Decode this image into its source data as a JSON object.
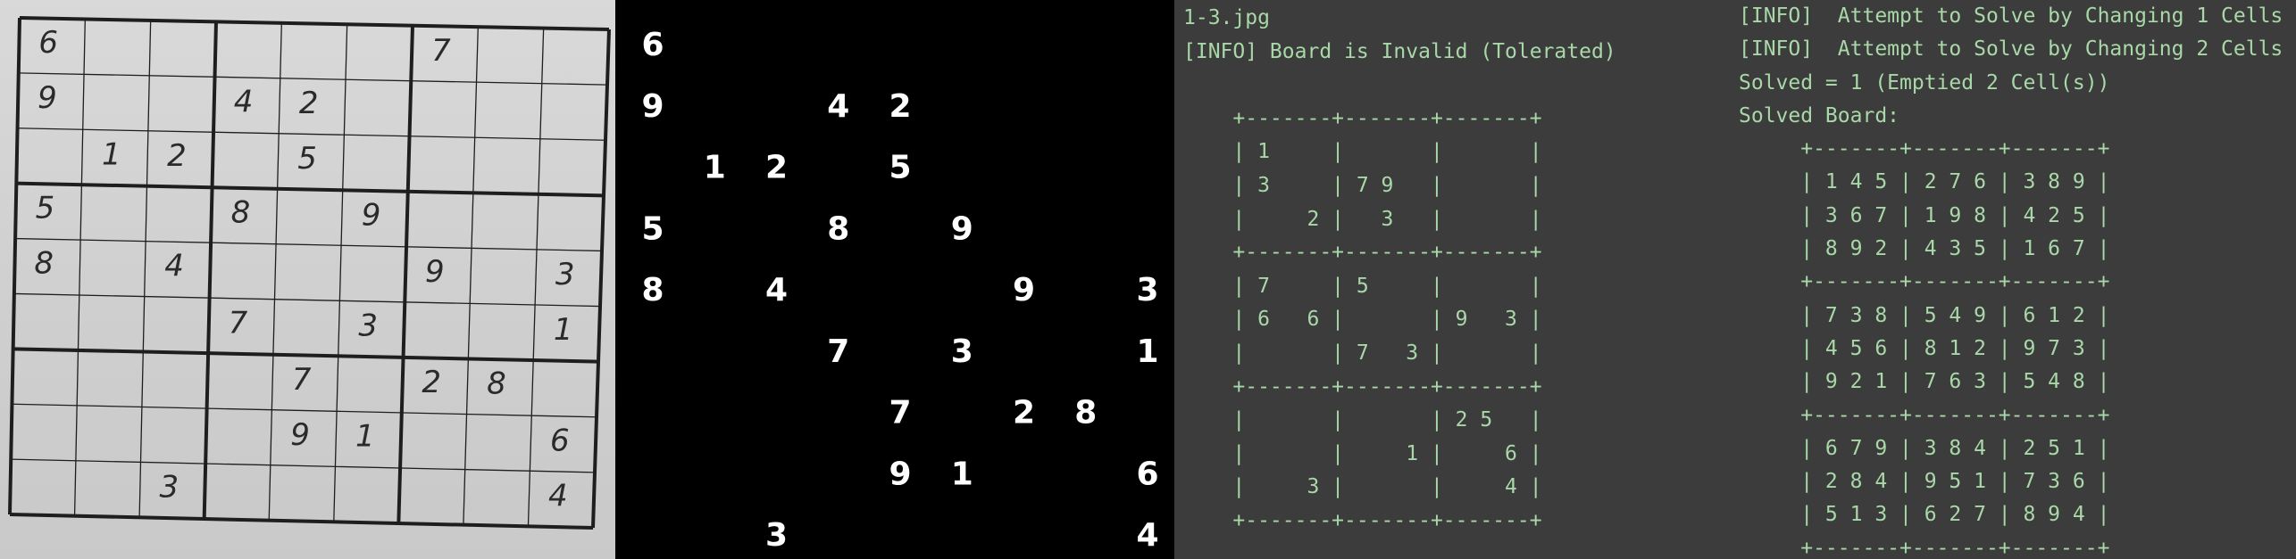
{
  "photo_board": {
    "rows": [
      [
        "6",
        "",
        "",
        "",
        "",
        "",
        "7",
        "",
        ""
      ],
      [
        "9",
        "",
        "",
        "4",
        "2",
        "",
        "",
        "",
        ""
      ],
      [
        "",
        "1",
        "2",
        "",
        "5",
        "",
        "",
        "",
        ""
      ],
      [
        "5",
        "",
        "",
        "8",
        "",
        "9",
        "",
        "",
        ""
      ],
      [
        "8",
        "",
        "4",
        "",
        "",
        "",
        "9",
        "",
        "3"
      ],
      [
        "",
        "",
        "",
        "7",
        "",
        "3",
        "",
        "",
        "1"
      ],
      [
        "",
        "",
        "",
        "",
        "7",
        "",
        "2",
        "8",
        ""
      ],
      [
        "",
        "",
        "",
        "",
        "9",
        "1",
        "",
        "",
        "6"
      ],
      [
        "",
        "",
        "3",
        "",
        "",
        "",
        "",
        "",
        "4"
      ]
    ]
  },
  "binary_board": {
    "rows": [
      [
        "6",
        "",
        "",
        "",
        "",
        "",
        "",
        "",
        ""
      ],
      [
        "9",
        "",
        "",
        "4",
        "2",
        "",
        "",
        "",
        ""
      ],
      [
        "",
        "1",
        "2",
        "",
        "5",
        "",
        "",
        "",
        ""
      ],
      [
        "5",
        "",
        "",
        "8",
        "",
        "9",
        "",
        "",
        ""
      ],
      [
        "8",
        "",
        "4",
        "",
        "",
        "",
        "9",
        "",
        "3"
      ],
      [
        "",
        "",
        "",
        "7",
        "",
        "3",
        "",
        "",
        "1"
      ],
      [
        "",
        "",
        "",
        "",
        "7",
        "",
        "2",
        "8",
        ""
      ],
      [
        "",
        "",
        "",
        "",
        "9",
        "1",
        "",
        "",
        "6"
      ],
      [
        "",
        "",
        "3",
        "",
        "",
        "",
        "",
        "",
        "4"
      ]
    ]
  },
  "terminal": {
    "left_lines": [
      "1-3.jpg",
      "[INFO] Board is Invalid (Tolerated)",
      "",
      "    +-------+-------+-------+",
      "    | 1     |       |       |",
      "    | 3     | 7 9   |       |",
      "    |     2 |   3   |       |",
      "    +-------+-------+-------+",
      "    | 7     | 5     |       |",
      "    | 6   6 |       | 9   3 |",
      "    |       | 7   3 |       |",
      "    +-------+-------+-------+",
      "    |       |       | 2 5   |",
      "    |       |     1 |     6 |",
      "    |     3 |       |     4 |",
      "    +-------+-------+-------+"
    ],
    "right_lines": [
      "[INFO]  Attempt to Solve by Changing 1 Cells",
      "[INFO]  Attempt to Solve by Changing 2 Cells",
      "Solved = 1 (Emptied 2 Cell(s))",
      "Solved Board:",
      "     +-------+-------+-------+",
      "     | 1 4 5 | 2 7 6 | 3 8 9 |",
      "     | 3 6 7 | 1 9 8 | 4 2 5 |",
      "     | 8 9 2 | 4 3 5 | 1 6 7 |",
      "     +-------+-------+-------+",
      "     | 7 3 8 | 5 4 9 | 6 1 2 |",
      "     | 4 5 6 | 8 1 2 | 9 7 3 |",
      "     | 9 2 1 | 7 6 3 | 5 4 8 |",
      "     +-------+-------+-------+",
      "     | 6 7 9 | 3 8 4 | 2 5 1 |",
      "     | 2 8 4 | 9 5 1 | 7 3 6 |",
      "     | 5 1 3 | 6 2 7 | 8 9 4 |",
      "     +-------+-------+-------+"
    ]
  },
  "colors": {
    "terminal_bg": "#3c3c3c",
    "terminal_text": "#a8d8a8",
    "photo_paper": "#d4d4d4",
    "ink": "#2a2a2a"
  }
}
